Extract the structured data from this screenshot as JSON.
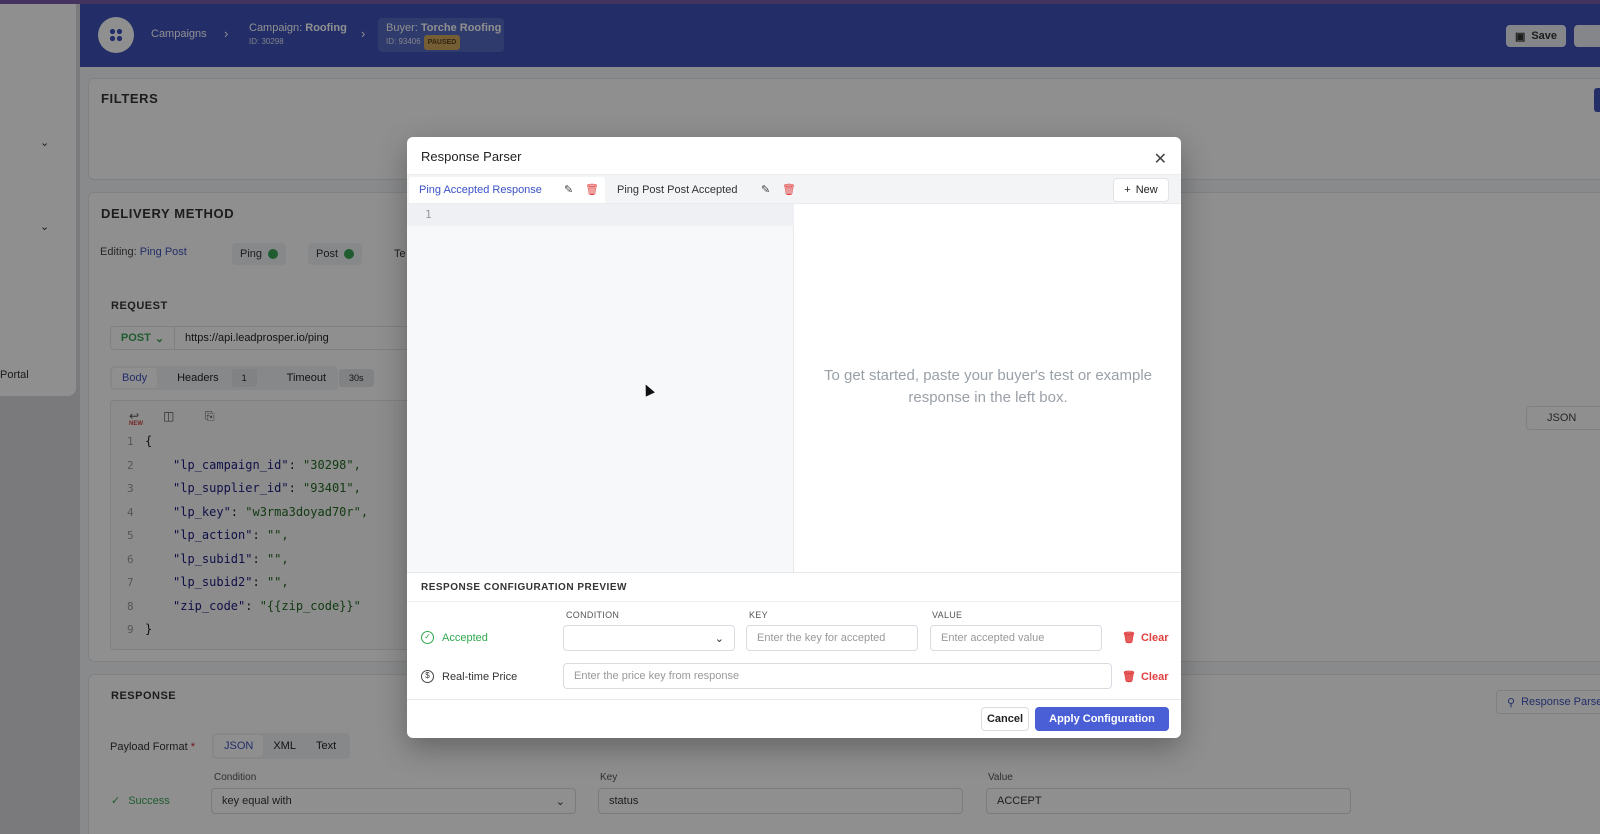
{
  "header": {
    "crumb_campaigns": "Campaigns",
    "campaign_label": "Campaign:",
    "campaign_name": "Roofing",
    "campaign_id": "ID: 30298",
    "buyer_label": "Buyer:",
    "buyer_name": "Torche Roofing",
    "buyer_id": "ID: 93406",
    "buyer_status": "PAUSED",
    "save_label": "Save"
  },
  "sidebar": {
    "portal_label": "Portal"
  },
  "filters": {
    "title": "FILTERS"
  },
  "delivery": {
    "title": "DELIVERY METHOD",
    "editing_label": "Editing:",
    "editing_value": "Ping Post",
    "steps": [
      "Ping",
      "Post",
      "Te"
    ]
  },
  "request": {
    "title": "REQUEST",
    "method": "POST",
    "url": "https://api.leadprosper.io/ping",
    "tabs": [
      "Body",
      "Headers",
      "Timeout"
    ],
    "headers_count": "1",
    "timeout_value": "30s",
    "new_badge": "NEW",
    "format": "JSON",
    "code_lines": [
      {
        "num": "1",
        "text": "{"
      },
      {
        "num": "2",
        "key": "\"lp_campaign_id\"",
        "val": "\"30298\","
      },
      {
        "num": "3",
        "key": "\"lp_supplier_id\"",
        "val": "\"93401\","
      },
      {
        "num": "4",
        "key": "\"lp_key\"",
        "val": "\"w3rma3doyad70r\","
      },
      {
        "num": "5",
        "key": "\"lp_action\"",
        "val": "\"\","
      },
      {
        "num": "6",
        "key": "\"lp_subid1\"",
        "val": "\"\","
      },
      {
        "num": "7",
        "key": "\"lp_subid2\"",
        "val": "\"\","
      },
      {
        "num": "8",
        "key": "\"zip_code\"",
        "val": "\"{{zip_code}}\""
      },
      {
        "num": "9",
        "text": "}"
      }
    ]
  },
  "response": {
    "title": "RESPONSE",
    "payload_label": "Payload Format",
    "formats": [
      "JSON",
      "XML",
      "Text"
    ],
    "condition_label": "Condition",
    "key_label": "Key",
    "value_label": "Value",
    "success_label": "Success",
    "condition_value": "key equal with",
    "key_value": "status",
    "value_value": "ACCEPT",
    "parser_button": "Response Parse"
  },
  "modal": {
    "title": "Response Parser",
    "tabs": [
      "Ping Accepted Response",
      "Ping Post Post Accepted"
    ],
    "new_label": "New",
    "line_one": "1",
    "placeholder_message": "To get started, paste your buyer's test or example response in the left box.",
    "preview_title": "RESPONSE CONFIGURATION PREVIEW",
    "col_condition": "CONDITION",
    "col_key": "KEY",
    "col_value": "VALUE",
    "accepted_label": "Accepted",
    "key_placeholder": "Enter the key for accepted",
    "value_placeholder": "Enter accepted value",
    "price_label": "Real-time Price",
    "price_placeholder": "Enter the price key from response",
    "clear_label": "Clear",
    "cancel_label": "Cancel",
    "apply_label": "Apply Configuration"
  },
  "colors": {
    "brand": "#3b52c6",
    "accent_button": "#4a5fd6",
    "success": "#2fa84f",
    "danger": "#e04040"
  }
}
